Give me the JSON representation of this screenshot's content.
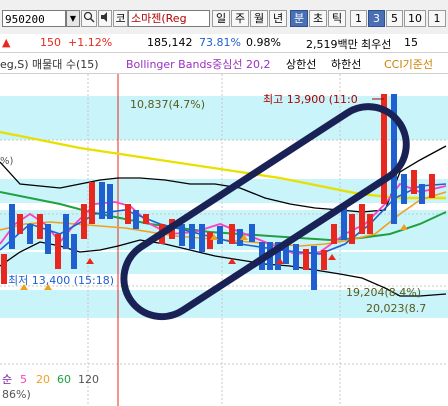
{
  "toolbar": {
    "stock_code": "950200",
    "market_label": "코",
    "stock_name": "소마젠(Reg",
    "period_buttons": [
      "일",
      "주",
      "월",
      "년"
    ],
    "minute_button": "분",
    "second_button": "초",
    "tick_button": "틱",
    "interval_buttons": [
      "1",
      "3",
      "5",
      "10"
    ],
    "active_interval": "3",
    "search_icon": "magnifier-icon",
    "speaker_icon": "speaker-icon"
  },
  "quote": {
    "change": "150",
    "change_pct": "+1.12%",
    "volume": "185,142",
    "ratio": "73.81%",
    "turnover_ratio": "0.98%",
    "amount": "2,519백만",
    "best_bid": "최우선",
    "best_bid_value": "15"
  },
  "indicators": {
    "volume_label": "eg,S) 매물대 수(15)",
    "bollinger_label": "Bollinger Bands중심선 20,2",
    "upper_label": "상한선",
    "lower_label": "하한선",
    "cci_label": "CCI기준선"
  },
  "chart": {
    "high_label": "최고 13,900 (11:0",
    "low_label": "최저 13,400 (15:18)",
    "level_1": "10,837(4.7%)",
    "level_2": "19,204(8.4%)",
    "level_3": "20,023(8.7",
    "ma_legend_prefix": "순",
    "ma_5": "5",
    "ma_20": "20",
    "ma_60": "60",
    "ma_120": "120",
    "bottom_pct": "86%)",
    "left_pct_fragment": "%)",
    "colors": {
      "rise": "#e8281e",
      "fall": "#1f5fd0",
      "ma5": "#ff3fbf",
      "ma20": "#f0a020",
      "ma60": "#20a040",
      "ma120": "#e8e000",
      "band": "#000000",
      "volume_profile": "#c8f4fa",
      "annotation": "#1a2255"
    }
  }
}
